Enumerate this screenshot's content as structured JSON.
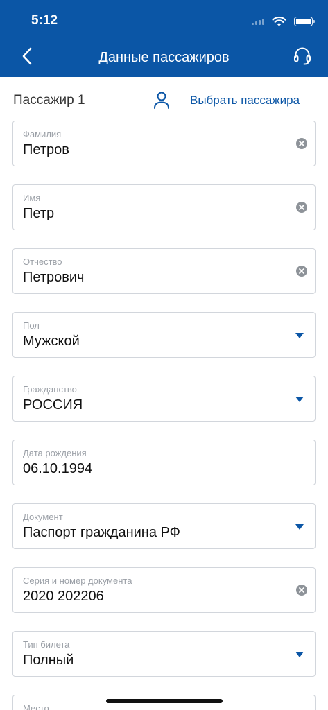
{
  "status_bar": {
    "time": "5:12"
  },
  "nav": {
    "title": "Данные пассажиров"
  },
  "passenger": {
    "title": "Пассажир 1",
    "choose_label": "Выбрать пассажира"
  },
  "fields": [
    {
      "label": "Фамилия",
      "value": "Петров",
      "control": "clear"
    },
    {
      "label": "Имя",
      "value": "Петр",
      "control": "clear"
    },
    {
      "label": "Отчество",
      "value": "Петрович",
      "control": "clear"
    },
    {
      "label": "Пол",
      "value": "Мужской",
      "control": "dropdown"
    },
    {
      "label": "Гражданство",
      "value": "РОССИЯ",
      "control": "dropdown"
    },
    {
      "label": "Дата рождения",
      "value": "06.10.1994",
      "control": "none"
    },
    {
      "label": "Документ",
      "value": "Паспорт гражданина РФ",
      "control": "dropdown"
    },
    {
      "label": "Серия и номер документа",
      "value": "2020 202206",
      "control": "clear"
    },
    {
      "label": "Тип билета",
      "value": "Полный",
      "control": "dropdown"
    },
    {
      "label": "Место",
      "value": "",
      "control": "none"
    }
  ],
  "icons": {
    "back": "chevron-left-icon",
    "support": "headset-icon",
    "passenger": "person-icon",
    "clear": "clear-circle-icon",
    "dropdown": "dropdown-triangle-icon"
  },
  "colors": {
    "header": "#0b56a6",
    "accent": "#0b56a6",
    "field_border": "#d2d6dc",
    "label": "#9a9fa6",
    "clear_icon": "#8e9399"
  }
}
